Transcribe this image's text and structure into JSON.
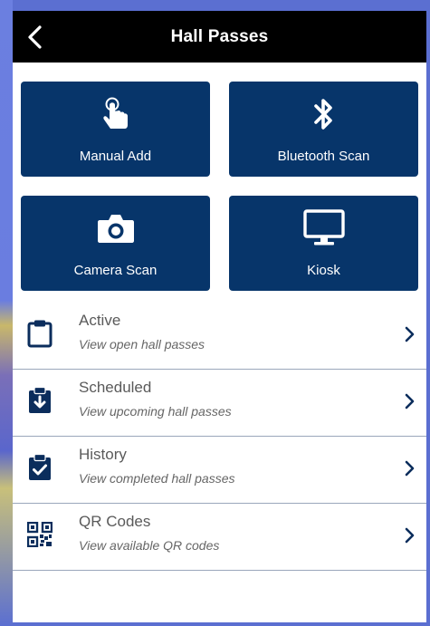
{
  "header": {
    "title": "Hall Passes",
    "back_icon": "chevron-left-icon"
  },
  "tiles": [
    {
      "label": "Manual Add",
      "icon": "tap-hand-icon"
    },
    {
      "label": "Bluetooth Scan",
      "icon": "bluetooth-icon"
    },
    {
      "label": "Camera Scan",
      "icon": "camera-icon"
    },
    {
      "label": "Kiosk",
      "icon": "monitor-icon"
    }
  ],
  "list": [
    {
      "title": "Active",
      "subtitle": "View open hall passes",
      "icon": "clipboard-icon"
    },
    {
      "title": "Scheduled",
      "subtitle": "View upcoming hall passes",
      "icon": "clipboard-download-icon"
    },
    {
      "title": "History",
      "subtitle": "View completed hall passes",
      "icon": "clipboard-check-icon"
    },
    {
      "title": "QR Codes",
      "subtitle": "View available QR codes",
      "icon": "qr-code-icon"
    }
  ],
  "colors": {
    "header_bg": "#000000",
    "tile_bg": "#07356a",
    "icon_navy": "#0b2d5c",
    "page_bg": "#5b6fd1"
  }
}
